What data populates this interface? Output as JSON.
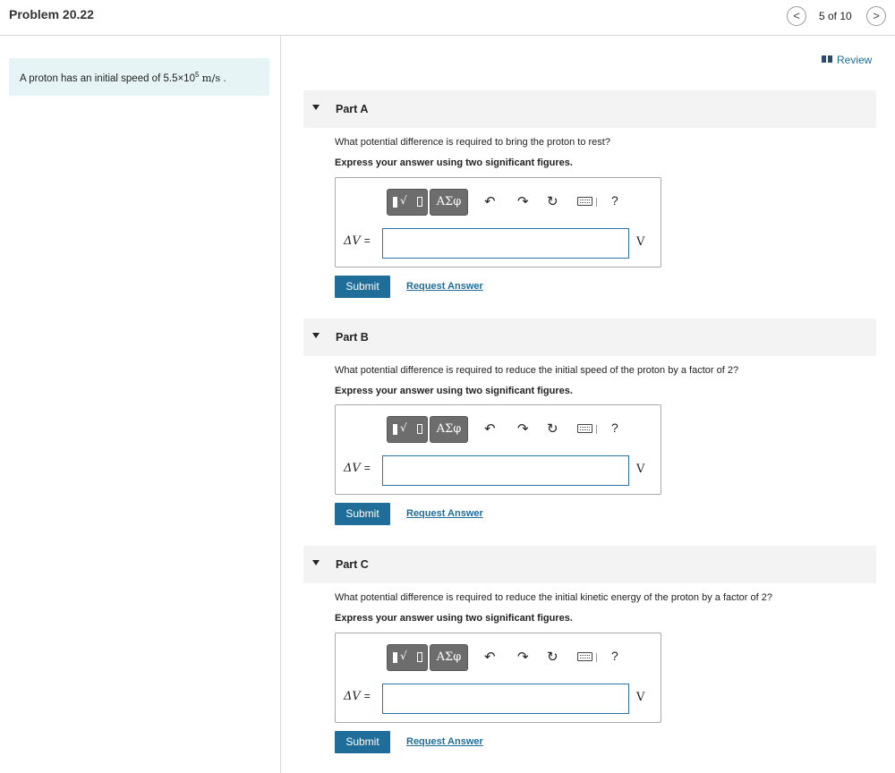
{
  "header": {
    "title": "Problem 20.22",
    "prev_symbol": "<",
    "counter": "5 of 10",
    "next_symbol": ">"
  },
  "problem": {
    "text": "A proton has an initial speed of 5.5×10",
    "exponent": "5",
    "unit": "m/s",
    "period": "."
  },
  "review_label": "Review",
  "toolbar": {
    "radical": "√",
    "greek": "ΑΣφ",
    "undo": "↶",
    "redo": "↷",
    "reset": "↻",
    "help": "?"
  },
  "parts": [
    {
      "label": "Part A",
      "question": "What potential difference is required to bring the proton to rest?",
      "instruction": "Express your answer using two significant figures.",
      "var": "ΔV",
      "eq": "=",
      "value": "",
      "unit": "V",
      "submit": "Submit",
      "request": "Request Answer"
    },
    {
      "label": "Part B",
      "question": "What potential difference is required to reduce the initial speed of the proton by a factor of 2?",
      "instruction": "Express your answer using two significant figures.",
      "var": "ΔV",
      "eq": "=",
      "value": "",
      "unit": "V",
      "submit": "Submit",
      "request": "Request Answer"
    },
    {
      "label": "Part C",
      "question": "What potential difference is required to reduce the initial kinetic energy of the proton by a factor of 2?",
      "instruction": "Express your answer using two significant figures.",
      "var": "ΔV",
      "eq": "=",
      "value": "",
      "unit": "V",
      "submit": "Submit",
      "request": "Request Answer"
    }
  ]
}
